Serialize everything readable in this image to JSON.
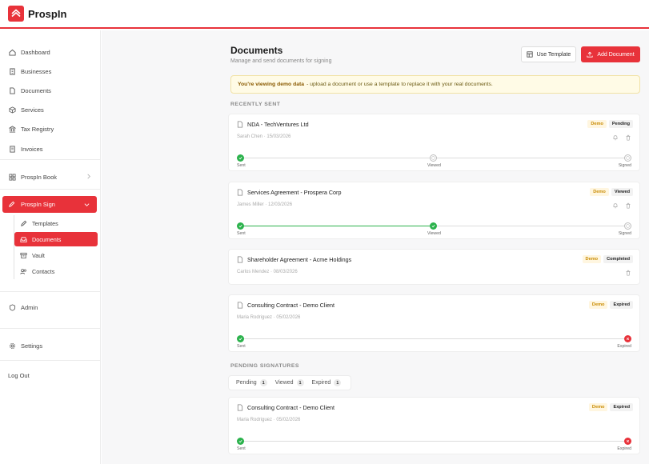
{
  "app": {
    "name": "ProspIn"
  },
  "sidebar": {
    "items": [
      {
        "label": "Dashboard",
        "icon": "home-icon"
      },
      {
        "label": "Businesses",
        "icon": "building-icon"
      },
      {
        "label": "Documents",
        "icon": "file-icon"
      },
      {
        "label": "Services",
        "icon": "box-icon"
      },
      {
        "label": "Tax Registry",
        "icon": "bank-icon"
      },
      {
        "label": "Invoices",
        "icon": "receipt-icon"
      }
    ],
    "book": {
      "label": "ProspIn Book"
    },
    "sign": {
      "label": "ProspIn Sign",
      "sub": [
        {
          "label": "Templates"
        },
        {
          "label": "Documents"
        },
        {
          "label": "Vault"
        },
        {
          "label": "Contacts"
        }
      ]
    },
    "admin": "Admin",
    "settings": "Settings",
    "logout": "Log Out"
  },
  "main": {
    "title": "Documents",
    "subtitle": "Manage and send documents for signing",
    "use_template": "Use Template",
    "add_document": "Add Document",
    "banner_bold": "You're viewing demo data",
    "banner_text": "- upload a document or use a template to replace it with your real documents.",
    "recent_title": "RECENTLY SENT",
    "pending_title": "PENDING SIGNATURES"
  },
  "steps": {
    "sent": "Sent",
    "viewed": "Viewed",
    "signed": "Signed",
    "expired": "Expired"
  },
  "docs": [
    {
      "title": "NDA - TechVentures Ltd",
      "meta": "Sarah Chen · 15/03/2026",
      "demo": "Demo",
      "status": "Pending",
      "progress": 0.0
    },
    {
      "title": "Services Agreement - Prospera Corp",
      "meta": "James Miller · 12/03/2026",
      "demo": "Demo",
      "status": "Viewed",
      "progress": 0.5
    },
    {
      "title": "Shareholder Agreement - Acme Holdings",
      "meta": "Carlos Mendez · 08/03/2026",
      "demo": "Demo",
      "status": "Completed"
    },
    {
      "title": "Consulting Contract - Demo Client",
      "meta": "Maria Rodriguez · 05/02/2026",
      "demo": "Demo",
      "status": "Expired"
    }
  ],
  "tabs": [
    {
      "label": "Pending",
      "count": "1"
    },
    {
      "label": "Viewed",
      "count": "1"
    },
    {
      "label": "Expired",
      "count": "1"
    }
  ],
  "pending_doc": {
    "title": "Consulting Contract - Demo Client",
    "meta": "Maria Rodriguez · 05/02/2026",
    "demo": "Demo",
    "status": "Expired"
  },
  "colors": {
    "accent": "#e8323a",
    "success": "#2bb24c",
    "demo": "#c88a00"
  }
}
